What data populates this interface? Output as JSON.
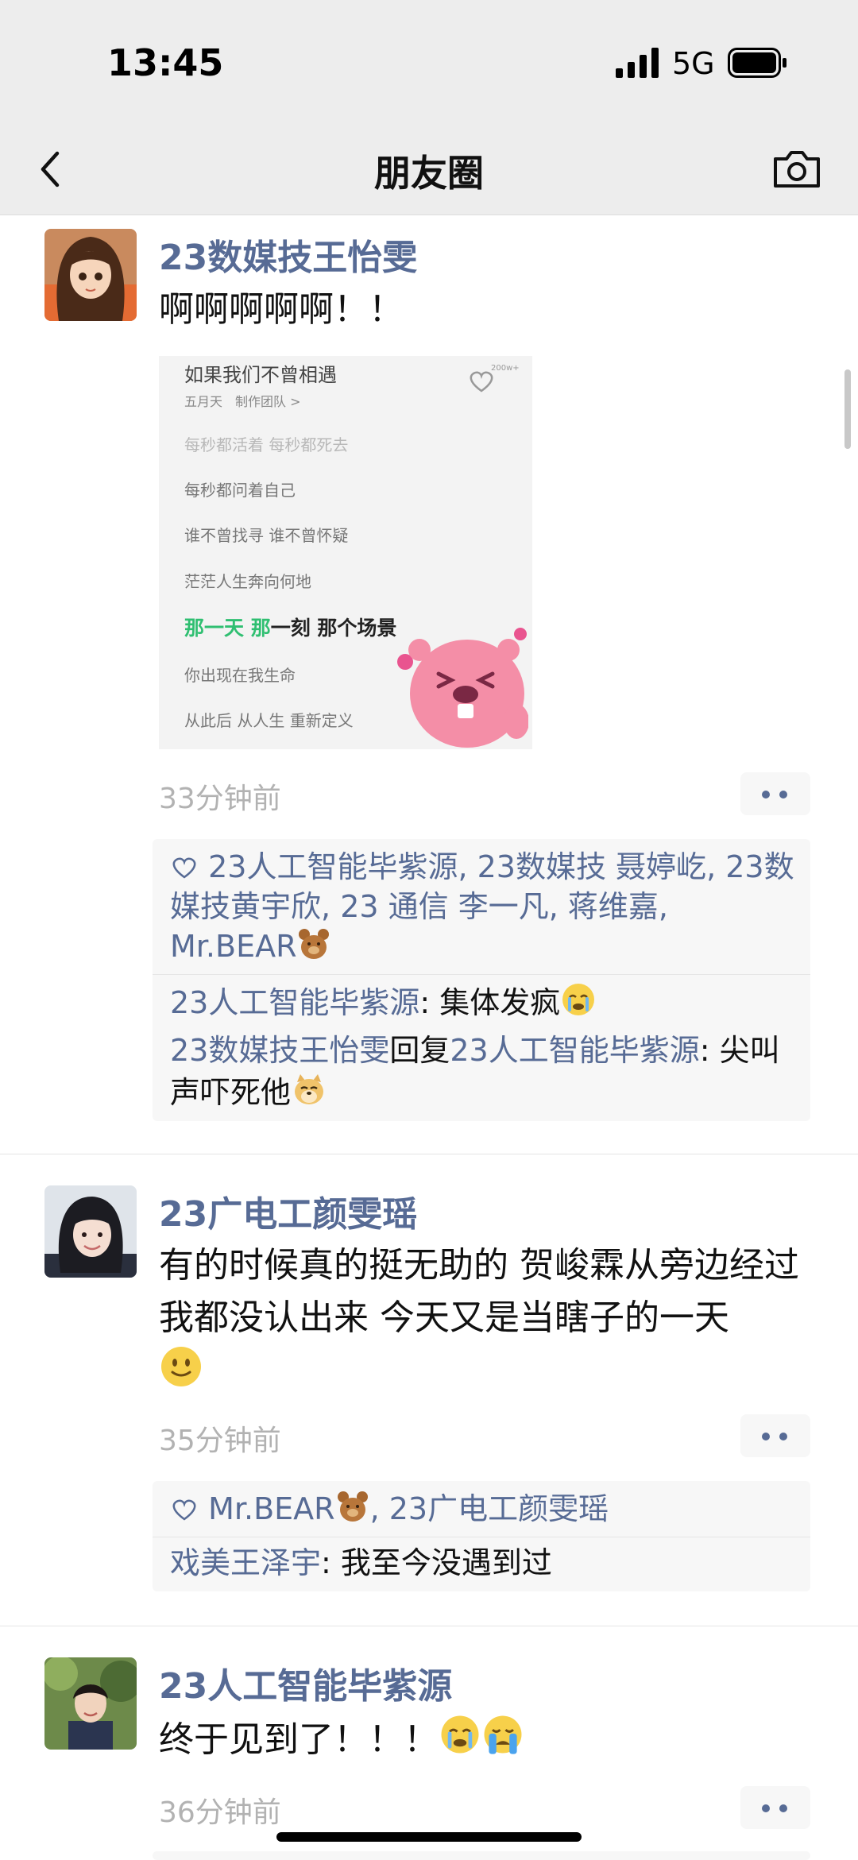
{
  "status": {
    "time": "13:45",
    "network": "5G"
  },
  "nav": {
    "title": "朋友圈"
  },
  "posts": [
    {
      "name": "23数媒技王怡雯",
      "text": "啊啊啊啊啊！！",
      "image": {
        "lines": [
          "如果我们不曾相遇",
          "五月天　制作团队 >",
          "每秒都活着 每秒都死去",
          "每秒都问着自己",
          "谁不曾找寻 谁不曾怀疑",
          "茫茫人生奔向何地",
          "那一天 那",
          "一刻 那个场景",
          "你出现在我生命",
          "从此后 从人生 重新定义"
        ],
        "like_count": "200w+"
      },
      "time": "33分钟前",
      "likes": [
        "23人工智能毕紫源",
        "23数媒技 聂婷屹",
        "23数媒技黄宇欣",
        "23 通信 李一凡",
        "蒋维嘉",
        "Mr.BEAR"
      ],
      "comments": [
        {
          "name": "23人工智能毕紫源",
          "text": "集体发疯"
        },
        {
          "name": "23数媒技王怡雯",
          "reply_word": "回复",
          "reply_to": "23人工智能毕紫源",
          "text": "尖叫声吓死他"
        }
      ]
    },
    {
      "name": "23广电工颜雯瑶",
      "text": "有的时候真的挺无助的 贺峻霖从旁边经过我都没认出来 今天又是当瞎子的一天",
      "time": "35分钟前",
      "likes": [
        "Mr.BEAR",
        "23广电工颜雯瑶"
      ],
      "comments": [
        {
          "name": "戏美王泽宇",
          "text": "我至今没遇到过"
        }
      ]
    },
    {
      "name": "23人工智能毕紫源",
      "text": "终于见到了！！！",
      "time": "36分钟前"
    }
  ],
  "colors": {
    "link": "#576b95",
    "meta": "#b2b2b2",
    "bar": "#ededed",
    "highlight_green": "#2fbf71"
  },
  "icons": [
    "back-icon",
    "camera-icon",
    "signal-icon",
    "battery-icon",
    "heart-icon",
    "more-icon",
    "bear-emoji",
    "tears-emoji",
    "doge-emoji",
    "smile-emoji",
    "crying-emoji"
  ]
}
